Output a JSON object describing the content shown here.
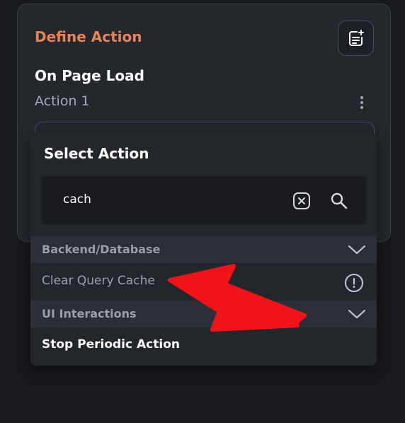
{
  "panel": {
    "title": "Define Action",
    "trigger": "On Page Load",
    "action_name": "Action 1"
  },
  "dropdown": {
    "title": "Select Action",
    "search": {
      "value": "cach",
      "placeholder": ""
    },
    "groups": [
      {
        "label": "Backend/Database",
        "items": [
          {
            "label": "Clear Query Cache",
            "disabled": true
          }
        ]
      },
      {
        "label": "UI Interactions",
        "items": [
          {
            "label": "Stop Periodic Action",
            "disabled": false
          }
        ]
      }
    ]
  },
  "icons": {
    "add_doc": "add-document-icon",
    "more": "more-vertical-icon",
    "clear": "clear-input-icon",
    "search": "search-icon",
    "chevron": "chevron-down-icon",
    "info": "info-circle-icon"
  },
  "annotation": {
    "color": "#f0141a",
    "type": "arrow",
    "points_to": "Clear Query Cache"
  },
  "colors": {
    "accent": "#e4845a",
    "panel_bg": "#24272c",
    "dropdown_bg": "#23262b",
    "category_bg": "#2c2f35",
    "text_primary": "#ffffff",
    "text_muted": "#9aa0a8"
  }
}
